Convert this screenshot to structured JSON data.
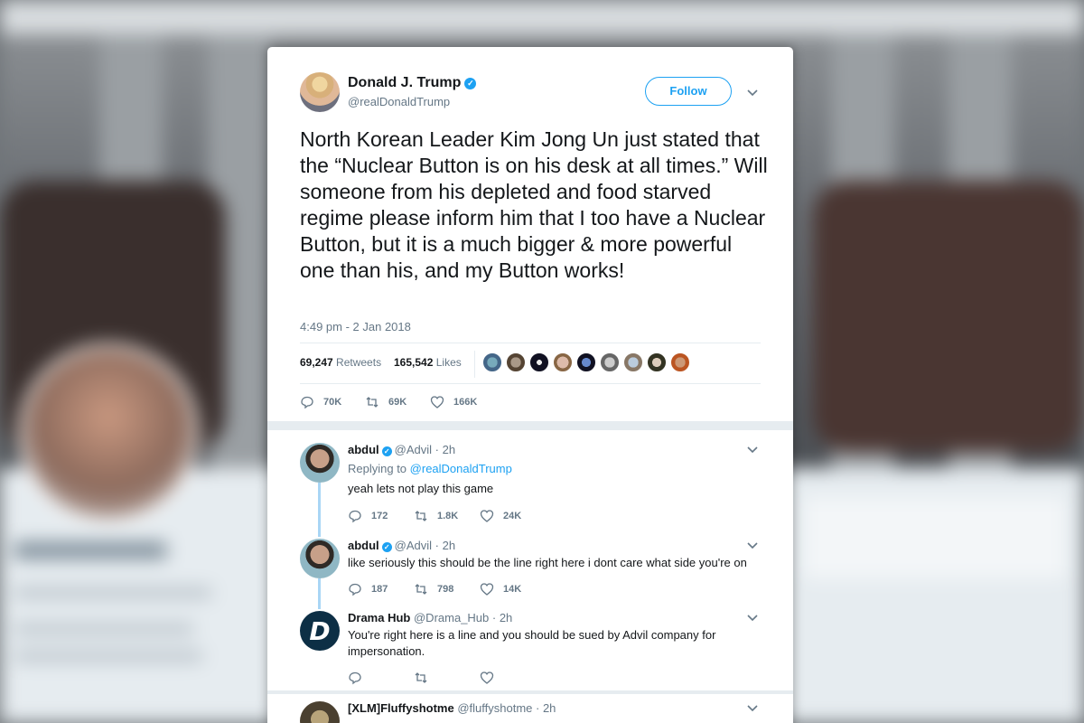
{
  "tweet": {
    "author_name": "Donald J. Trump",
    "author_handle": "@realDonaldTrump",
    "follow_label": "Follow",
    "text": "North Korean Leader Kim Jong Un just stated that the “Nuclear Button is on his desk at all times.” Will someone from his depleted and food starved regime please inform him that I too have a Nuclear Button, but it is a much bigger & more powerful one than his, and my Button works!",
    "timestamp": "4:49 pm - 2 Jan 2018",
    "retweets_count": "69,247",
    "retweets_label": "Retweets",
    "likes_count": "165,542",
    "likes_label": "Likes",
    "actions": {
      "replies": "70K",
      "retweets": "69K",
      "likes": "166K"
    }
  },
  "replies": [
    {
      "name": "abdul",
      "handle": "@Advil",
      "time": "· 2h",
      "replying_prefix": "Replying to",
      "replying_to": "@realDonaldTrump",
      "text": "yeah lets not play this game",
      "actions": {
        "replies": "172",
        "retweets": "1.8K",
        "likes": "24K"
      }
    },
    {
      "name": "abdul",
      "handle": "@Advil",
      "time": "· 2h",
      "text": "like seriously this should be the line right here i dont care what side you're on",
      "actions": {
        "replies": "187",
        "retweets": "798",
        "likes": "14K"
      }
    },
    {
      "name": "Drama Hub",
      "handle": "@Drama_Hub",
      "time": "· 2h",
      "text": "You're right here is a line and you should be sued by Advil company for impersonation.",
      "avatar_letter": "D",
      "actions": {
        "replies": "",
        "retweets": "",
        "likes": ""
      }
    },
    {
      "name": "[XLM]Fluffyshotme",
      "handle": "@fluffyshotme",
      "time": "· 2h"
    }
  ],
  "colors": {
    "accent": "#1da1f2",
    "text_primary": "#14171a",
    "text_secondary": "#657786",
    "thread_line": "#a9d6f5",
    "divider": "#e6ecf0"
  },
  "icons": [
    "verified-badge-icon",
    "chevron-down-icon",
    "reply-icon",
    "retweet-icon",
    "like-heart-icon"
  ]
}
